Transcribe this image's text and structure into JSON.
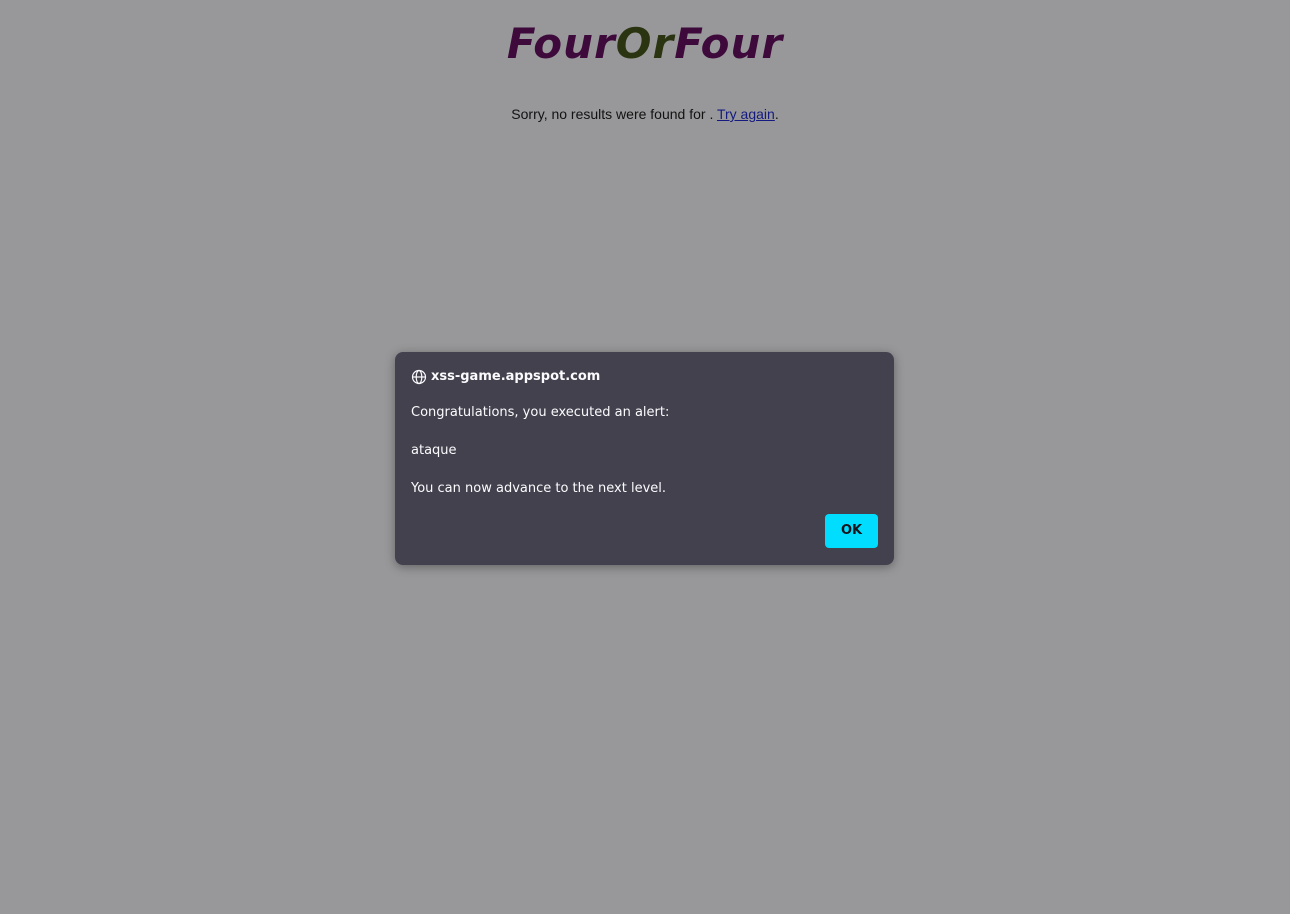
{
  "logo": {
    "part1": "Four",
    "part2": "Or",
    "part3": "Four"
  },
  "results": {
    "message": "Sorry, no results were found for . ",
    "try_again_link": "Try again",
    "trailing": "."
  },
  "alert_dialog": {
    "origin": "xss-game.appspot.com",
    "origin_icon": "globe-icon",
    "line1": "Congratulations, you executed an alert:",
    "line2": "ataque",
    "line3": "You can now advance to the next level.",
    "ok_label": "OK"
  },
  "colors": {
    "page_background": "#98989a",
    "dialog_background": "#42414d",
    "ok_button": "#00ddff",
    "link": "#141a80",
    "logo_primary": "#3d0a3b",
    "logo_secondary": "#2a3411"
  }
}
